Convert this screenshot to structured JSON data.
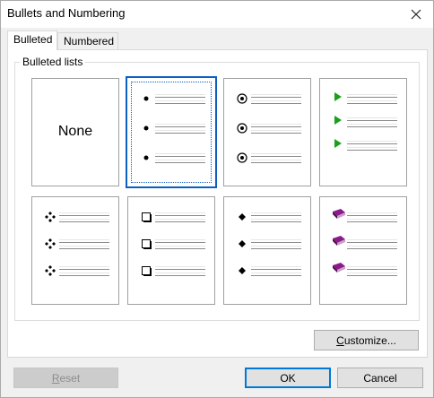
{
  "window": {
    "title": "Bullets and Numbering"
  },
  "tabs": [
    {
      "label": "Bulleted",
      "active": true
    },
    {
      "label": "Numbered",
      "active": false
    }
  ],
  "group": {
    "label": "Bulleted lists"
  },
  "tiles": [
    {
      "id": "none",
      "label": "None"
    },
    {
      "id": "small-dot",
      "icon": "small-filled-circle-bullet"
    },
    {
      "id": "circle-dot",
      "icon": "circle-with-dot-bullet"
    },
    {
      "id": "arrow",
      "icon": "green-triangle-bullet",
      "color": "#1aa01a"
    },
    {
      "id": "diamond-four",
      "icon": "four-diamond-bullet"
    },
    {
      "id": "square",
      "icon": "hollow-square-bullet"
    },
    {
      "id": "diamond",
      "icon": "small-diamond-bullet"
    },
    {
      "id": "book",
      "icon": "purple-book-bullet",
      "color": "#8b1a8b"
    }
  ],
  "selected_tile": "small-dot",
  "buttons": {
    "customize": {
      "prefix": "",
      "underlined": "C",
      "suffix": "ustomize..."
    },
    "reset": {
      "underlined": "R",
      "suffix": "eset",
      "disabled": true
    },
    "ok": "OK",
    "cancel": "Cancel"
  },
  "colors": {
    "accent": "#0078d7",
    "selected_outline": "#0b5fc0"
  }
}
